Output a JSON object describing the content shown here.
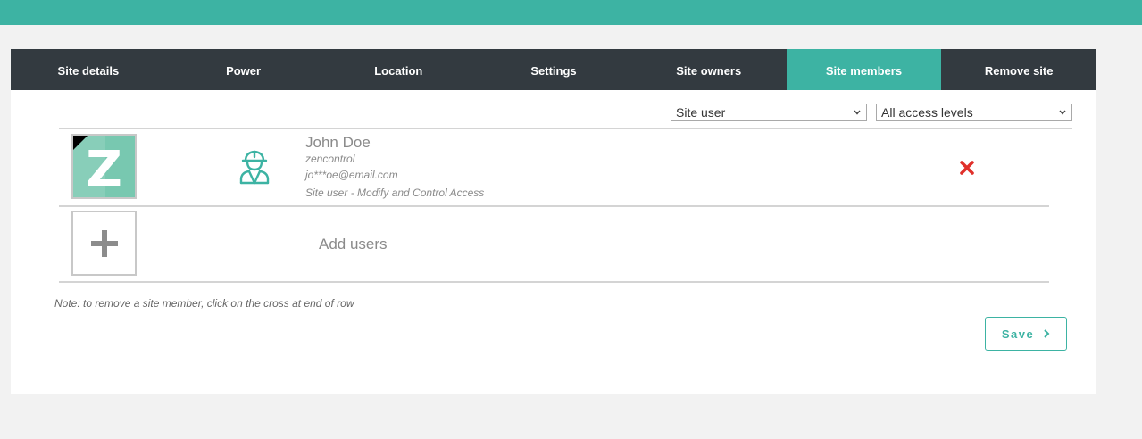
{
  "tabs": [
    {
      "label": "Site details"
    },
    {
      "label": "Power"
    },
    {
      "label": "Location"
    },
    {
      "label": "Settings"
    },
    {
      "label": "Site owners"
    },
    {
      "label": "Site members",
      "active": true
    },
    {
      "label": "Remove site"
    }
  ],
  "filters": {
    "role": "Site user",
    "access": "All access levels"
  },
  "members": [
    {
      "avatar_letter": "Z",
      "role_icon": "worker-icon",
      "name": "John Doe",
      "organisation": "zencontrol",
      "email": "jo***oe@email.com",
      "access": "Site user - Modify and Control Access"
    }
  ],
  "add_users_label": "Add users",
  "note": "Note: to remove a site member, click on the cross at end of row",
  "save_label": "Save",
  "colors": {
    "accent": "#3db3a3",
    "tab_bar": "#333a40",
    "remove": "#e0302b",
    "avatar_bg": "#78c8b0"
  }
}
